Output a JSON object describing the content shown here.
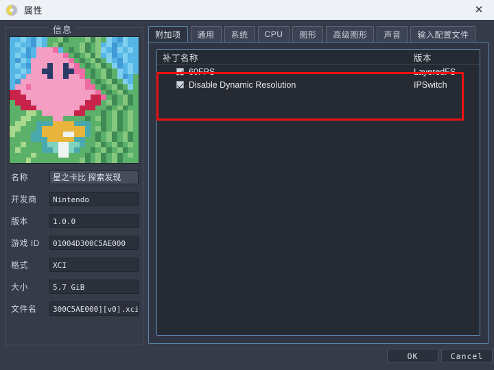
{
  "window": {
    "title": "属性",
    "logo_icon": "yuzu-logo-icon",
    "close_icon": "close-icon",
    "close_label": "✕"
  },
  "info_panel": {
    "legend": "信息",
    "cover_art_name": "game-cover-art",
    "fields": [
      {
        "label": "名称",
        "value": "星之卡比 探索发现",
        "mono": false
      },
      {
        "label": "开发商",
        "value": "Nintendo",
        "mono": true
      },
      {
        "label": "版本",
        "value": "1.0.0",
        "mono": true
      },
      {
        "label": "游戏 ID",
        "value": "01004D300C5AE000",
        "mono": true
      },
      {
        "label": "格式",
        "value": "XCI",
        "mono": true
      },
      {
        "label": "大小",
        "value": "5.7 GiB",
        "mono": true
      },
      {
        "label": "文件名",
        "value": "300C5AE000][v0].xci",
        "mono": true
      }
    ]
  },
  "tabs": [
    {
      "label": "附加项",
      "active": true
    },
    {
      "label": "通用",
      "active": false
    },
    {
      "label": "系统",
      "active": false
    },
    {
      "label": "CPU",
      "active": false
    },
    {
      "label": "图形",
      "active": false
    },
    {
      "label": "高级图形",
      "active": false
    },
    {
      "label": "声音",
      "active": false
    },
    {
      "label": "输入配置文件",
      "active": false
    }
  ],
  "patch_list": {
    "columns": [
      "补丁名称",
      "版本"
    ],
    "rows": [
      {
        "checked": true,
        "name": "60FPS",
        "version": "LayeredFS"
      },
      {
        "checked": true,
        "name": "Disable Dynamic Resolution",
        "version": "IPSwitch"
      }
    ]
  },
  "annotation": {
    "highlight_color": "#ee1111"
  },
  "buttons": {
    "ok": "OK",
    "cancel": "Cancel"
  }
}
